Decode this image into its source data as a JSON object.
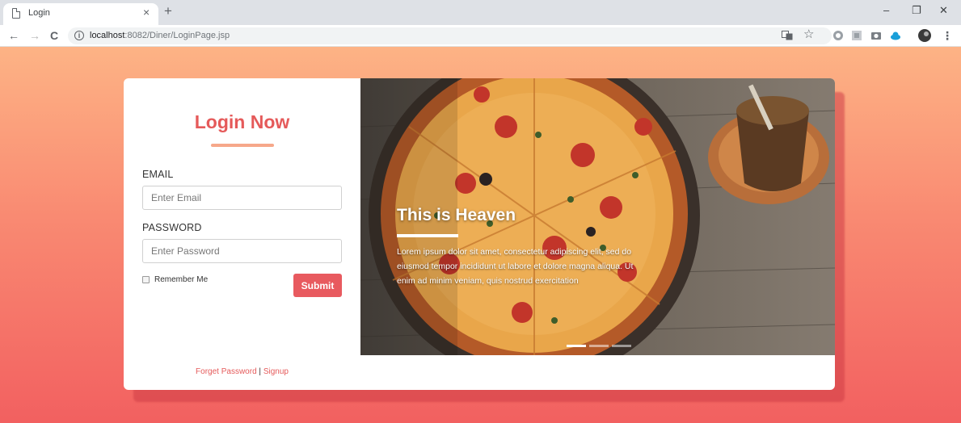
{
  "browser": {
    "tab_title": "Login",
    "tab_close": "×",
    "new_tab": "+",
    "window": {
      "minimize": "–",
      "restore": "❐",
      "close": "✕"
    },
    "nav": {
      "back": "←",
      "forward": "→",
      "reload": "C"
    },
    "info": "i",
    "url_host": "localhost",
    "url_rest": ":8082/Diner/LoginPage.jsp",
    "menu": "⋮",
    "star": "☆"
  },
  "login": {
    "title": "Login Now",
    "email_label": "EMAIL",
    "email_placeholder": "Enter Email",
    "email_value": "",
    "password_label": "PASSWORD",
    "password_placeholder": "Enter Password",
    "password_value": "",
    "remember_label": "Remember Me",
    "submit_label": "Submit",
    "forget_password": "Forget Password",
    "separator": "|",
    "signup": "Signup"
  },
  "hero": {
    "title": "This is Heaven",
    "text": "Lorem ipsum dolor sit amet, consectetur adipiscing elit, sed do eiusmod tempor incididunt ut labore et dolore magna aliqua. Ut enim ad minim veniam, quis nostrud exercitation"
  },
  "colors": {
    "accent": "#e55a5a",
    "button": "#e85a5f",
    "gradient_top": "#fdb385",
    "gradient_bottom": "#f26060"
  }
}
